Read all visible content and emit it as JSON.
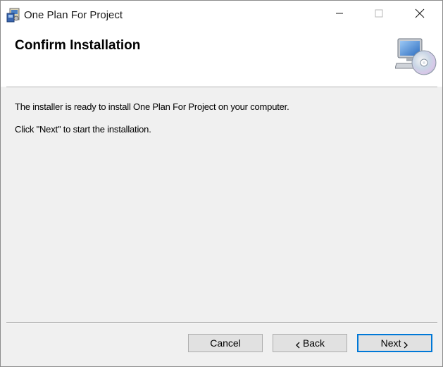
{
  "window": {
    "title": "One Plan For Project",
    "app_icon": "installer-icon",
    "controls": {
      "minimize": "minimize-icon",
      "maximize": "maximize-icon",
      "close": "close-icon"
    }
  },
  "header": {
    "title": "Confirm Installation",
    "icon": "computer-cd-icon"
  },
  "content": {
    "line1": "The installer is ready to install One Plan For Project on your computer.",
    "line2": "Click \"Next\" to start the installation."
  },
  "buttons": {
    "cancel": "Cancel",
    "back": "Back",
    "next": "Next"
  },
  "colors": {
    "accent": "#0078d7",
    "dialog_bg": "#f0f0f0",
    "header_bg": "#ffffff"
  }
}
